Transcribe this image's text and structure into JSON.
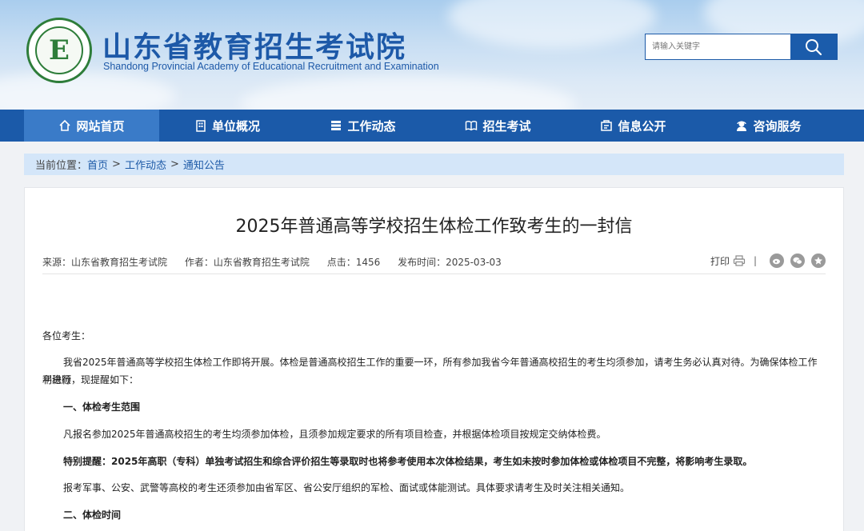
{
  "header": {
    "logo_letter": "E",
    "title": "山东省教育招生考试院",
    "subtitle": "Shandong Provincial Academy of Educational Recruitment and Examination"
  },
  "search": {
    "placeholder": "请输入关键字",
    "icon": "search-icon"
  },
  "nav": {
    "items": [
      {
        "label": "网站首页",
        "icon": "home-icon",
        "active": true
      },
      {
        "label": "单位概况",
        "icon": "building-icon"
      },
      {
        "label": "工作动态",
        "icon": "news-icon"
      },
      {
        "label": "招生考试",
        "icon": "book-icon"
      },
      {
        "label": "信息公开",
        "icon": "info-box-icon"
      },
      {
        "label": "咨询服务",
        "icon": "user-service-icon"
      }
    ]
  },
  "breadcrumb": {
    "prefix": "当前位置：",
    "items": [
      "首页",
      "工作动态",
      "通知公告"
    ],
    "separator": ">"
  },
  "article": {
    "title": "2025年普通高等学校招生体检工作致考生的一封信",
    "meta": {
      "source": "来源：山东省教育招生考试院",
      "author": "作者：山东省教育招生考试院",
      "clicks": "点击：1456",
      "date": "发布时间：2025-03-03"
    },
    "tools": {
      "print": "打印",
      "divider": "|"
    },
    "paragraphs": {
      "greeting": "各位考生：",
      "intro_line1": "我省2025年普通高等学校招生体检工作即将开展。体检是普通高校招生工作的重要一环，所有参加我省今年普通高校招生的考生均须参加，请考生务必认真对待。为确保体检工作平稳顺",
      "intro_line2": "利进行，现提醒如下：",
      "section1": "一、体检考生范围",
      "scope": "凡报名参加2025年普通高校招生的考生均须参加体检，且须参加规定要求的所有项目检查，并根据体检项目按规定交纳体检费。",
      "special": "特别提醒：2025年高职（专科）单独考试招生和综合评价招生等录取时也将参考使用本次体检结果，考生如未按时参加体检或体检项目不完整，将影响考生录取。",
      "military": "报考军事、公安、武警等高校的考生还须参加由省军区、省公安厅组织的军检、面试或体能测试。具体要求请考生及时关注相关通知。",
      "section2": "二、体检时间"
    }
  }
}
